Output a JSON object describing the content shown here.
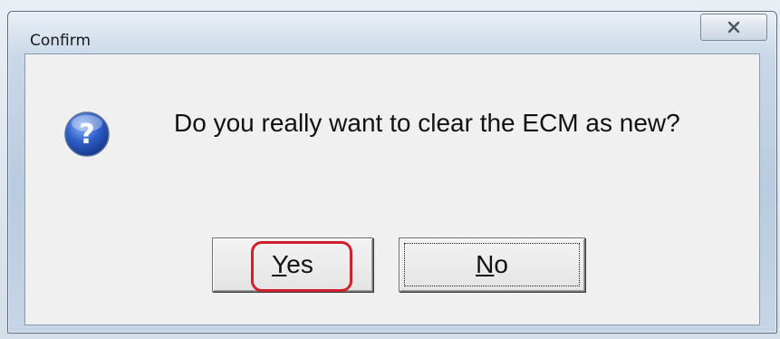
{
  "dialog": {
    "title": "Confirm",
    "close_icon": "close-icon",
    "message_icon": "question-icon",
    "message": "Do you really want to clear the ECM as new?",
    "buttons": {
      "yes": {
        "mnemonic": "Y",
        "rest": "es"
      },
      "no": {
        "mnemonic": "N",
        "rest": "o"
      }
    },
    "highlight_color": "#d0212a",
    "focused_button": "No"
  }
}
